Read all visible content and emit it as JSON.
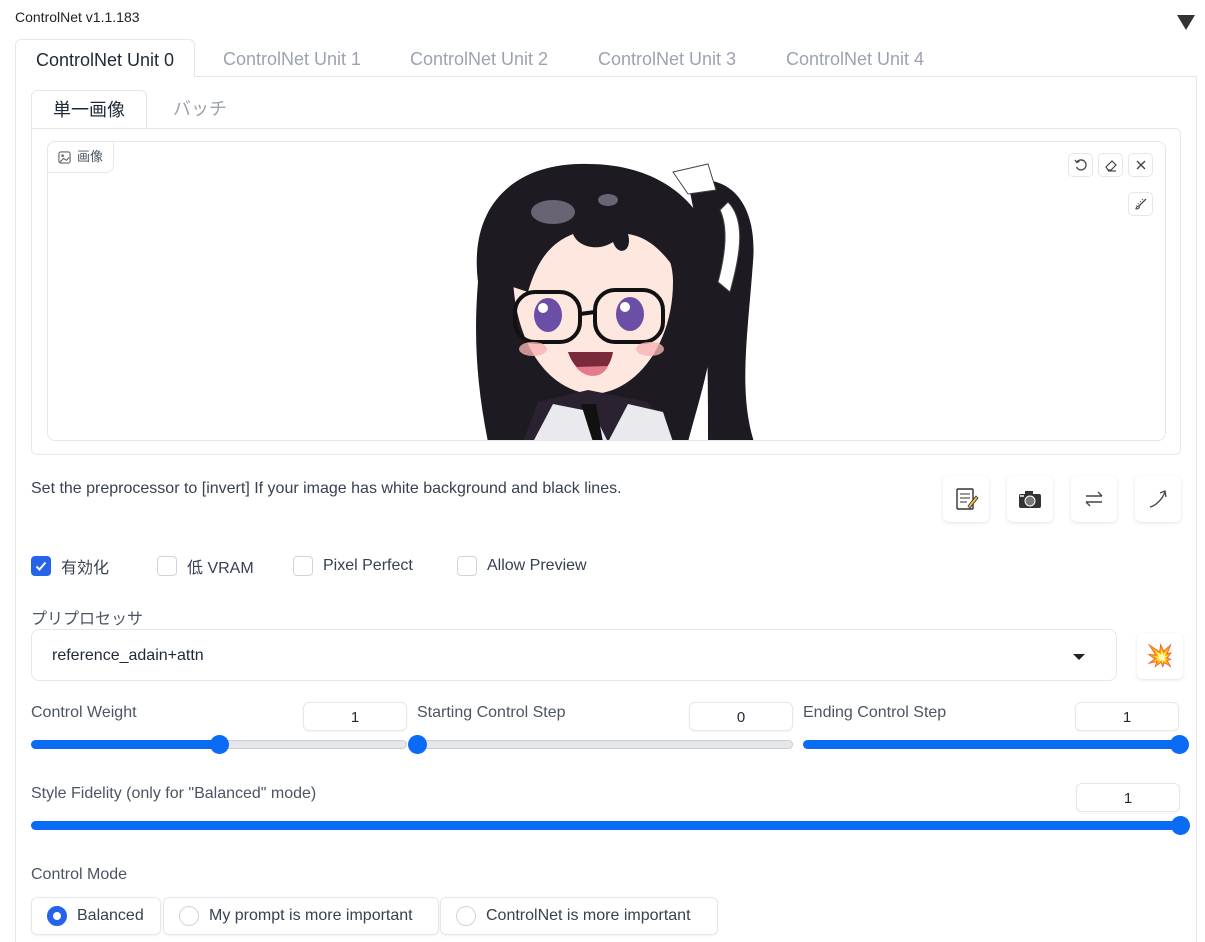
{
  "header": {
    "title": "ControlNet v1.1.183"
  },
  "unit_tabs": [
    "ControlNet Unit 0",
    "ControlNet Unit 1",
    "ControlNet Unit 2",
    "ControlNet Unit 3",
    "ControlNet Unit 4"
  ],
  "image_tabs": [
    "単一画像",
    "バッチ"
  ],
  "image_panel": {
    "label": "画像"
  },
  "hint": "Set the preprocessor to [invert] If your image has white background and black lines.",
  "checkboxes": [
    {
      "label": "有効化",
      "checked": true
    },
    {
      "label": "低 VRAM",
      "checked": false
    },
    {
      "label": "Pixel Perfect",
      "checked": false
    },
    {
      "label": "Allow Preview",
      "checked": false
    }
  ],
  "preprocessor": {
    "label": "プリプロセッサ",
    "value": "reference_adain+attn",
    "run_icon": "💥"
  },
  "sliders": {
    "control_weight": {
      "label": "Control Weight",
      "value": "1",
      "fraction": 0.5
    },
    "starting_step": {
      "label": "Starting Control Step",
      "value": "0",
      "fraction": 0
    },
    "ending_step": {
      "label": "Ending Control Step",
      "value": "1",
      "fraction": 1
    },
    "style_fidelity": {
      "label": "Style Fidelity (only for \"Balanced\" mode)",
      "value": "1",
      "fraction": 1
    }
  },
  "control_mode": {
    "label": "Control Mode",
    "options": [
      "Balanced",
      "My prompt is more important",
      "ControlNet is more important"
    ],
    "selected": "Balanced"
  },
  "icons": [
    "image-icon",
    "undo-icon",
    "eraser-icon",
    "close-icon",
    "brush-icon",
    "memo-icon",
    "camera-icon",
    "swap-icon",
    "send-icon",
    "collision-icon"
  ],
  "colors": {
    "accent": "#0a6cf5",
    "checkbox": "#2563eb"
  }
}
